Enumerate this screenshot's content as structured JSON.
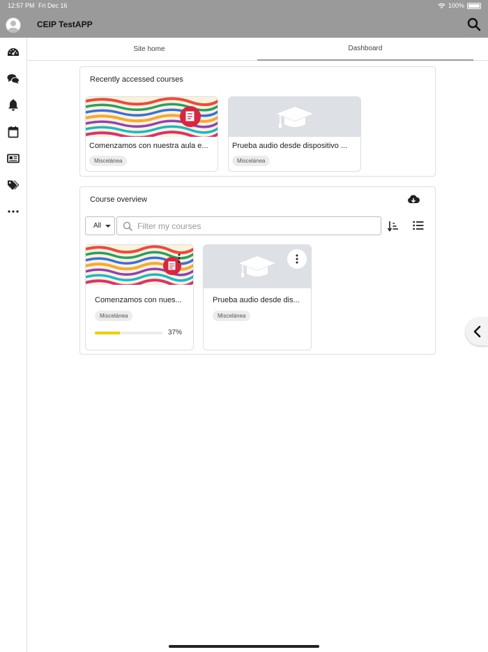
{
  "status_bar": {
    "time": "12:57 PM",
    "date": "Fri Dec 16",
    "battery": "100%"
  },
  "header": {
    "title": "CEIP TestAPP"
  },
  "sidebar": {
    "items": [
      {
        "icon": "dashboard-gauge-icon"
      },
      {
        "icon": "messages-icon"
      },
      {
        "icon": "notifications-bell-icon"
      },
      {
        "icon": "calendar-icon"
      },
      {
        "icon": "news-icon"
      },
      {
        "icon": "tags-icon"
      },
      {
        "icon": "more-icon"
      }
    ]
  },
  "tabs": [
    {
      "label": "Site home",
      "active": false
    },
    {
      "label": "Dashboard",
      "active": true
    }
  ],
  "recent": {
    "heading": "Recently accessed courses",
    "courses": [
      {
        "name": "Comenzamos con nuestra aula e...",
        "category": "Miscelánea",
        "image": "watercolor"
      },
      {
        "name": "Prueba audio desde dispositivo ...",
        "category": "Miscelánea",
        "image": "placeholder"
      }
    ]
  },
  "overview": {
    "heading": "Course overview",
    "filter_value": "All",
    "search_placeholder": "Filter my courses",
    "courses": [
      {
        "name": "Comenzamos con nues...",
        "category": "Miscelánea",
        "progress": 37,
        "progress_label": "37%",
        "image": "watercolor"
      },
      {
        "name": "Prueba audio desde dis...",
        "category": "Miscelánea",
        "image": "placeholder"
      }
    ]
  },
  "colors": {
    "header_bg": "#9a9a9a",
    "progress": "#f2cf00",
    "placeholder_bg": "#dde1e5"
  }
}
